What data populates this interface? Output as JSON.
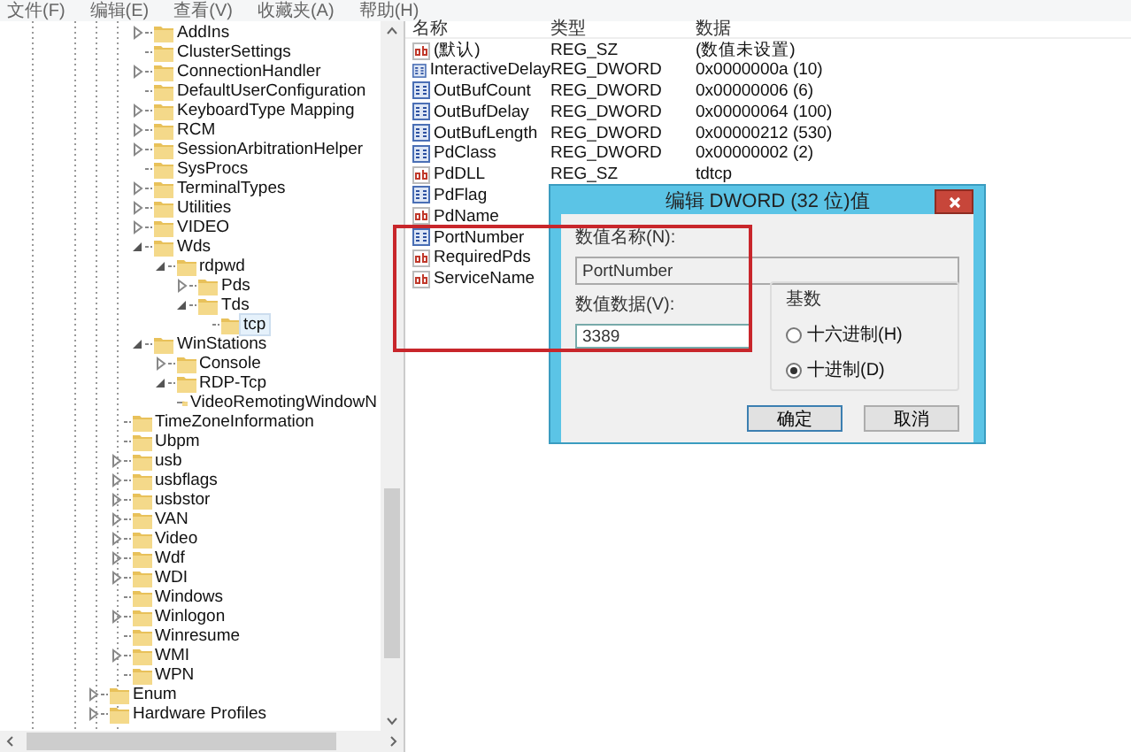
{
  "menu_bar": [
    "文件(F)",
    "编辑(E)",
    "查看(V)",
    "收藏夹(A)",
    "帮助(H)"
  ],
  "tree": {
    "children": [
      {
        "children": [
          {
            "children": [
              {
                "label": "AddIns",
                "expanded": false,
                "selected": false
              },
              {
                "label": "ClusterSettings",
                "selected": false
              },
              {
                "label": "ConnectionHandler",
                "expanded": false,
                "selected": false
              },
              {
                "label": "DefaultUserConfiguration",
                "selected": false
              },
              {
                "label": "KeyboardType Mapping",
                "expanded": false,
                "selected": false
              },
              {
                "label": "RCM",
                "expanded": false,
                "selected": false
              },
              {
                "label": "SessionArbitrationHelper",
                "expanded": false,
                "selected": false
              },
              {
                "label": "SysProcs",
                "selected": false
              },
              {
                "label": "TerminalTypes",
                "expanded": false,
                "selected": false
              },
              {
                "label": "Utilities",
                "expanded": false,
                "selected": false
              },
              {
                "label": "VIDEO",
                "expanded": false,
                "selected": false
              },
              {
                "label": "Wds",
                "expanded": true,
                "selected": false,
                "children": [
                  {
                    "label": "rdpwd",
                    "expanded": true,
                    "selected": false,
                    "children": [
                      {
                        "label": "Pds",
                        "expanded": false,
                        "selected": false
                      },
                      {
                        "label": "Tds",
                        "expanded": true,
                        "selected": false,
                        "children": [
                          {
                            "label": "tcp",
                            "selected": true
                          }
                        ]
                      }
                    ]
                  }
                ]
              },
              {
                "label": "WinStations",
                "expanded": true,
                "selected": false,
                "children": [
                  {
                    "label": "Console",
                    "expanded": false,
                    "selected": false
                  },
                  {
                    "label": "RDP-Tcp",
                    "expanded": true,
                    "selected": false,
                    "children": [
                      {
                        "label": "VideoRemotingWindowN",
                        "selected": false
                      }
                    ]
                  }
                ]
              }
            ]
          },
          {
            "label": "TimeZoneInformation",
            "selected": false
          },
          {
            "label": "Ubpm",
            "selected": false
          },
          {
            "label": "usb",
            "expanded": false,
            "selected": false
          },
          {
            "label": "usbflags",
            "expanded": false,
            "selected": false
          },
          {
            "label": "usbstor",
            "expanded": false,
            "selected": false
          },
          {
            "label": "VAN",
            "expanded": false,
            "selected": false
          },
          {
            "label": "Video",
            "expanded": false,
            "selected": false
          },
          {
            "label": "Wdf",
            "expanded": false,
            "selected": false
          },
          {
            "label": "WDI",
            "expanded": false,
            "selected": false
          },
          {
            "label": "Windows",
            "selected": false
          },
          {
            "label": "Winlogon",
            "expanded": false,
            "selected": false
          },
          {
            "label": "Winresume",
            "selected": false
          },
          {
            "label": "WMI",
            "expanded": false,
            "selected": false
          },
          {
            "label": "WPN",
            "selected": false
          }
        ]
      },
      {
        "label": "Enum",
        "expanded": false,
        "selected": false
      },
      {
        "label": "Hardware Profiles",
        "expanded": false,
        "selected": false
      }
    ]
  },
  "values_table": {
    "columns": [
      "名称",
      "类型",
      "数据"
    ],
    "rows": [
      {
        "kind": "string",
        "name": "(默认)",
        "type": "REG_SZ",
        "data": "(数值未设置)"
      },
      {
        "kind": "dword",
        "name": "InteractiveDelay",
        "type": "REG_DWORD",
        "data": "0x0000000a (10)"
      },
      {
        "kind": "dword",
        "name": "OutBufCount",
        "type": "REG_DWORD",
        "data": "0x00000006 (6)"
      },
      {
        "kind": "dword",
        "name": "OutBufDelay",
        "type": "REG_DWORD",
        "data": "0x00000064 (100)"
      },
      {
        "kind": "dword",
        "name": "OutBufLength",
        "type": "REG_DWORD",
        "data": "0x00000212 (530)"
      },
      {
        "kind": "dword",
        "name": "PdClass",
        "type": "REG_DWORD",
        "data": "0x00000002 (2)"
      },
      {
        "kind": "string",
        "name": "PdDLL",
        "type": "REG_SZ",
        "data": "tdtcp"
      },
      {
        "kind": "dword",
        "name": "PdFlag"
      },
      {
        "kind": "string",
        "name": "PdName"
      },
      {
        "kind": "dword",
        "name": "PortNumber"
      },
      {
        "kind": "string",
        "name": "RequiredPds"
      },
      {
        "kind": "string",
        "name": "ServiceName"
      }
    ]
  },
  "dialog": {
    "title": "编辑 DWORD (32 位)值",
    "name_label": "数值名称(N):",
    "name_value": "PortNumber",
    "data_label": "数值数据(V):",
    "data_value": "3389",
    "base_group": {
      "title": "基数",
      "options": [
        {
          "label": "十六进制(H)",
          "selected": false
        },
        {
          "label": "十进制(D)",
          "selected": true
        }
      ]
    },
    "buttons": [
      "确定",
      "取消"
    ]
  }
}
